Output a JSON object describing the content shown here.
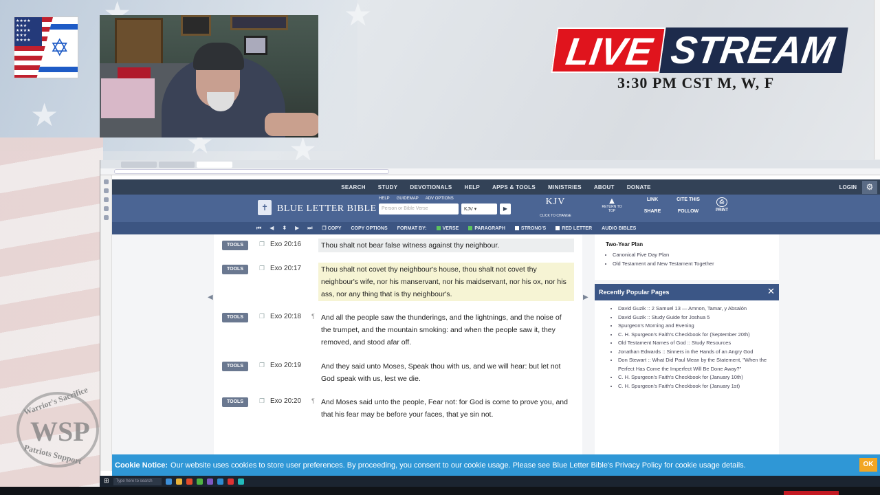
{
  "overlay": {
    "live_word": "LIVE",
    "stream_word": "STREAM",
    "schedule": "3:30 PM  CST  M, W, F",
    "logo_top": "Warrior's Sacrifice",
    "logo_monogram": "WSP",
    "logo_bottom": "Patriots Support",
    "colors": {
      "live_red": "#e0141d",
      "stream_navy": "#1d2b4c"
    }
  },
  "site": {
    "nav": [
      "SEARCH",
      "STUDY",
      "DEVOTIONALS",
      "HELP",
      "APPS & TOOLS",
      "MINISTRIES",
      "ABOUT",
      "DONATE"
    ],
    "login": "LOGIN",
    "brand": "BLUE LETTER BIBLE",
    "search_options": [
      "HELP",
      "GUIDEMAP",
      "ADV OPTIONS"
    ],
    "search_placeholder": "Person or Bible Verse",
    "version_select": "KJV",
    "version_title": "KJV",
    "version_sub": "CLICK TO CHANGE",
    "return_top": "RETURN TO TOP",
    "header_links": [
      "LINK",
      "CITE THIS",
      "SHARE",
      "FOLLOW"
    ],
    "print": "PRINT",
    "toolbar": {
      "copy": "COPY",
      "copy_options": "COPY OPTIONS",
      "format_by": "FORMAT BY:",
      "verse": "VERSE",
      "paragraph": "PARAGRAPH",
      "strongs": "STRONG'S",
      "red_letter": "RED LETTER",
      "audio_bibles": "AUDIO BIBLES"
    },
    "tools_label": "TOOLS",
    "verses": [
      {
        "ref": "Exo 20:16",
        "text": "Thou shalt not bear false witness against thy neighbour."
      },
      {
        "ref": "Exo 20:17",
        "text": "Thou shalt not covet thy neighbour's house, thou shalt not covet thy neighbour's wife, nor his manservant, nor his maidservant, nor his ox, nor his ass, nor any thing that is thy neighbour's."
      },
      {
        "ref": "Exo 20:18",
        "text": "And all the people saw the thunderings, and the lightnings, and the noise of the trumpet, and the mountain smoking: and when the people saw it, they removed, and stood afar off."
      },
      {
        "ref": "Exo 20:19",
        "text": "And they said unto Moses, Speak thou with us, and we will hear: but let not God speak with us, lest we die."
      },
      {
        "ref": "Exo 20:20",
        "text": "And Moses said unto the people, Fear not: for God is come to prove you, and that his fear may be before your faces, that ye sin not."
      }
    ],
    "two_year_plan": {
      "title": "Two-Year Plan",
      "items": [
        "Canonical Five Day Plan",
        "Old Testament and New Testament Together"
      ]
    },
    "popular": {
      "title": "Recently Popular Pages",
      "items": [
        "David Guzik :: 2 Samuel 13 — Amnon, Tamar, y Absalón",
        "David Guzik :: Study Guide for Joshua 5",
        "Spurgeon's Morning and Evening",
        "C. H. Spurgeon's Faith's Checkbook for (September 20th)",
        "Old Testament Names of God :: Study Resources",
        "Jonathan Edwards :: Sinners in the Hands of an Angry God",
        "Don Stewart :: What Did Paul Mean by the Statement, \"When the Perfect Has Come the Imperfect Will Be Done Away?\"",
        "C. H. Spurgeon's Faith's Checkbook for (January 10th)",
        "C. H. Spurgeon's Faith's Checkbook for (January 1st)"
      ]
    },
    "cookie": {
      "label": "Cookie Notice:",
      "text": "Our website uses cookies to store user preferences. By proceeding, you consent to our cookie usage. Please see Blue Letter Bible's Privacy Policy for cookie usage details.",
      "ok": "OK"
    }
  },
  "taskbar": {
    "search_placeholder": "Type here to search"
  }
}
